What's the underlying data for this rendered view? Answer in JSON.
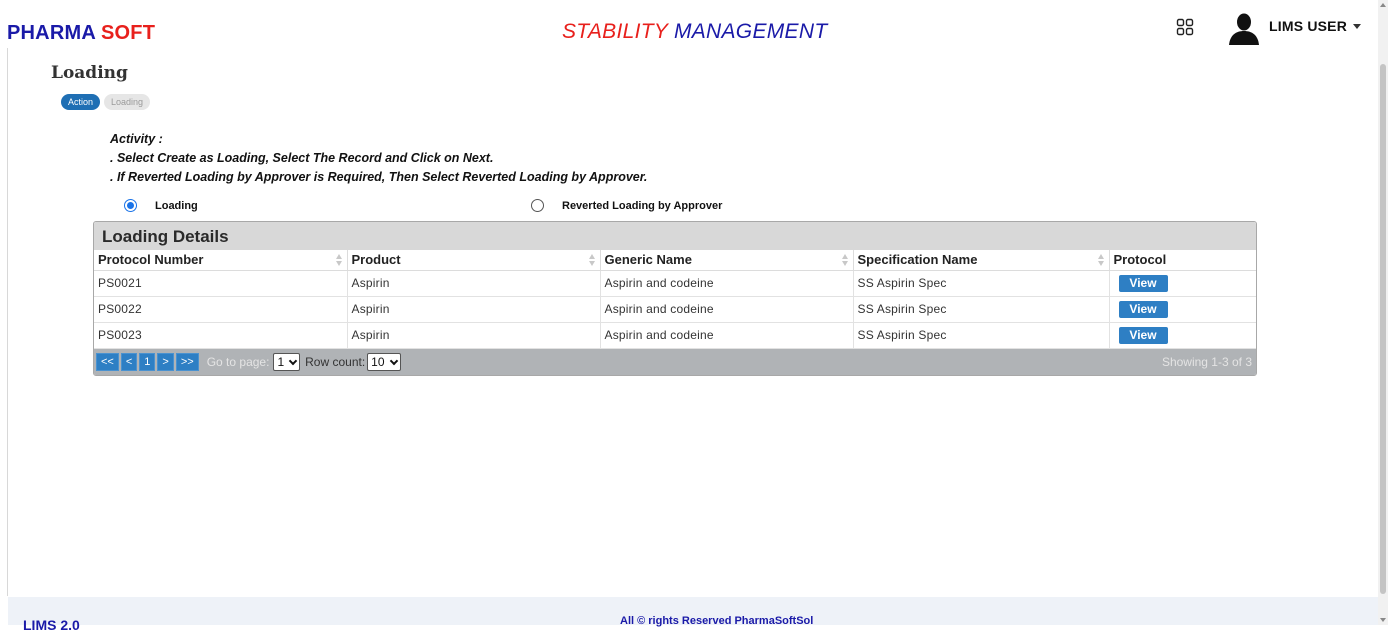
{
  "header": {
    "brand_part1": "PHARMA",
    "brand_part2": "SOFT",
    "title_part1": "STABILITY",
    "title_part2": "MANAGEMENT",
    "user_name": "LIMS USER",
    "apps_icon": "apps-grid-icon",
    "user_icon": "user-avatar-icon"
  },
  "page": {
    "title": "Loading",
    "breadcrumb": [
      "Action",
      "Loading"
    ]
  },
  "activity": {
    "heading": "Activity :",
    "lines": [
      ". Select Create as Loading, Select The Record and Click on Next.",
      ". If Reverted Loading by Approver is Required, Then Select Reverted Loading by Approver."
    ]
  },
  "radios": [
    {
      "label": "Loading",
      "checked": true
    },
    {
      "label": "Reverted Loading by Approver",
      "checked": false
    }
  ],
  "grid": {
    "caption": "Loading Details",
    "columns": [
      "Protocol Number",
      "Product",
      "Generic Name",
      "Specification Name",
      "Protocol"
    ],
    "rows": [
      {
        "protocol_number": "PS0021",
        "product": "Aspirin",
        "generic_name": "Aspirin and codeine",
        "specification_name": "SS Aspirin Spec",
        "action": "View"
      },
      {
        "protocol_number": "PS0022",
        "product": "Aspirin",
        "generic_name": "Aspirin and codeine",
        "specification_name": "SS Aspirin Spec",
        "action": "View"
      },
      {
        "protocol_number": "PS0023",
        "product": "Aspirin",
        "generic_name": "Aspirin and codeine",
        "specification_name": "SS Aspirin Spec",
        "action": "View"
      }
    ],
    "pager": {
      "first": "<<",
      "prev": "<",
      "current_page": "1",
      "next": ">",
      "last": ">>",
      "goto_label": "Go to page:",
      "goto_value": "1",
      "rowcount_label": "Row count:",
      "rowcount_value": "10",
      "info": "Showing 1-3 of 3"
    }
  },
  "footer": {
    "left": "LIMS 2.0",
    "center": "All © rights Reserved PharmaSoftSol"
  },
  "colors": {
    "brand_blue": "#1a1aa8",
    "brand_red": "#e8201c",
    "button_blue": "#2e7fc4"
  }
}
